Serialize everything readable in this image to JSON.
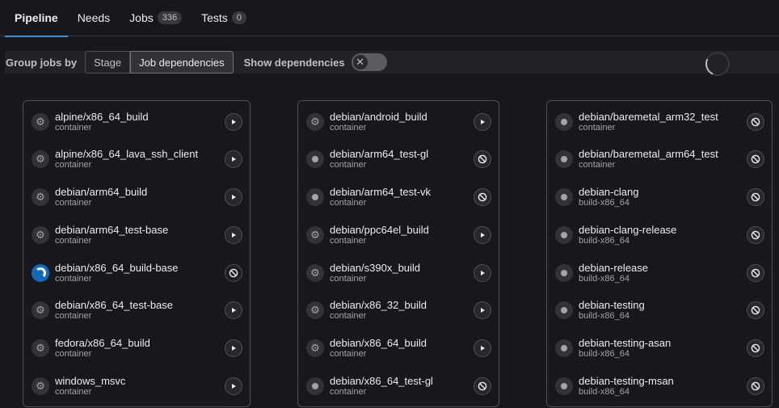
{
  "tabs": [
    {
      "label": "Pipeline",
      "count": null,
      "active": true
    },
    {
      "label": "Needs",
      "count": null,
      "active": false
    },
    {
      "label": "Jobs",
      "count": "336",
      "active": false
    },
    {
      "label": "Tests",
      "count": "0",
      "active": false
    }
  ],
  "toolbar": {
    "group_label": "Group jobs by",
    "stage_label": "Stage",
    "job_deps_label": "Job dependencies",
    "show_deps_label": "Show dependencies",
    "show_deps_on": false
  },
  "columns": [
    {
      "jobs": [
        {
          "name": "alpine/x86_64_build",
          "stage": "container",
          "status_icon": "gear-icon",
          "action_icon": "play-icon"
        },
        {
          "name": "alpine/x86_64_lava_ssh_client",
          "stage": "container",
          "status_icon": "gear-icon",
          "action_icon": "play-icon"
        },
        {
          "name": "debian/arm64_build",
          "stage": "container",
          "status_icon": "gear-icon",
          "action_icon": "play-icon"
        },
        {
          "name": "debian/arm64_test-base",
          "stage": "container",
          "status_icon": "gear-icon",
          "action_icon": "play-icon"
        },
        {
          "name": "debian/x86_64_build-base",
          "stage": "container",
          "status_icon": "running-icon",
          "action_icon": "cancel-icon"
        },
        {
          "name": "debian/x86_64_test-base",
          "stage": "container",
          "status_icon": "gear-icon",
          "action_icon": "play-icon"
        },
        {
          "name": "fedora/x86_64_build",
          "stage": "container",
          "status_icon": "gear-icon",
          "action_icon": "play-icon"
        },
        {
          "name": "windows_msvc",
          "stage": "container",
          "status_icon": "gear-icon",
          "action_icon": "play-icon"
        }
      ]
    },
    {
      "jobs": [
        {
          "name": "debian/android_build",
          "stage": "container",
          "status_icon": "gear-icon",
          "action_icon": "play-icon"
        },
        {
          "name": "debian/arm64_test-gl",
          "stage": "container",
          "status_icon": "created-icon",
          "action_icon": "cancel-icon"
        },
        {
          "name": "debian/arm64_test-vk",
          "stage": "container",
          "status_icon": "created-icon",
          "action_icon": "cancel-icon"
        },
        {
          "name": "debian/ppc64el_build",
          "stage": "container",
          "status_icon": "gear-icon",
          "action_icon": "play-icon"
        },
        {
          "name": "debian/s390x_build",
          "stage": "container",
          "status_icon": "gear-icon",
          "action_icon": "play-icon"
        },
        {
          "name": "debian/x86_32_build",
          "stage": "container",
          "status_icon": "gear-icon",
          "action_icon": "play-icon"
        },
        {
          "name": "debian/x86_64_build",
          "stage": "container",
          "status_icon": "gear-icon",
          "action_icon": "play-icon"
        },
        {
          "name": "debian/x86_64_test-gl",
          "stage": "container",
          "status_icon": "created-icon",
          "action_icon": "cancel-icon"
        }
      ]
    },
    {
      "jobs": [
        {
          "name": "debian/baremetal_arm32_test",
          "stage": "container",
          "status_icon": "created-icon",
          "action_icon": "cancel-icon"
        },
        {
          "name": "debian/baremetal_arm64_test",
          "stage": "container",
          "status_icon": "created-icon",
          "action_icon": "cancel-icon"
        },
        {
          "name": "debian-clang",
          "stage": "build-x86_64",
          "status_icon": "created-icon",
          "action_icon": "cancel-icon"
        },
        {
          "name": "debian-clang-release",
          "stage": "build-x86_64",
          "status_icon": "created-icon",
          "action_icon": "cancel-icon"
        },
        {
          "name": "debian-release",
          "stage": "build-x86_64",
          "status_icon": "created-icon",
          "action_icon": "cancel-icon"
        },
        {
          "name": "debian-testing",
          "stage": "build-x86_64",
          "status_icon": "created-icon",
          "action_icon": "cancel-icon"
        },
        {
          "name": "debian-testing-asan",
          "stage": "build-x86_64",
          "status_icon": "created-icon",
          "action_icon": "cancel-icon"
        },
        {
          "name": "debian-testing-msan",
          "stage": "build-x86_64",
          "status_icon": "created-icon",
          "action_icon": "cancel-icon"
        }
      ]
    }
  ]
}
